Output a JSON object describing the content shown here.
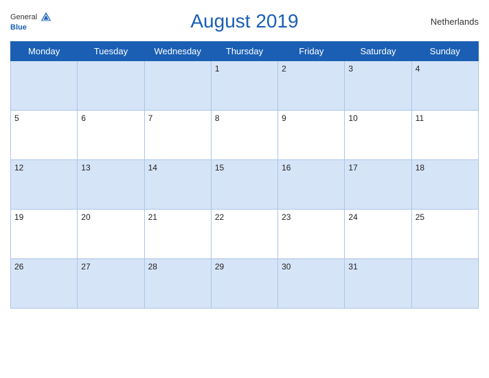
{
  "header": {
    "month_year": "August 2019",
    "country": "Netherlands",
    "logo_general": "General",
    "logo_blue": "Blue"
  },
  "weekdays": [
    "Monday",
    "Tuesday",
    "Wednesday",
    "Thursday",
    "Friday",
    "Saturday",
    "Sunday"
  ],
  "weeks": [
    [
      null,
      null,
      null,
      1,
      2,
      3,
      4
    ],
    [
      5,
      6,
      7,
      8,
      9,
      10,
      11
    ],
    [
      12,
      13,
      14,
      15,
      16,
      17,
      18
    ],
    [
      19,
      20,
      21,
      22,
      23,
      24,
      25
    ],
    [
      26,
      27,
      28,
      29,
      30,
      31,
      null
    ]
  ]
}
